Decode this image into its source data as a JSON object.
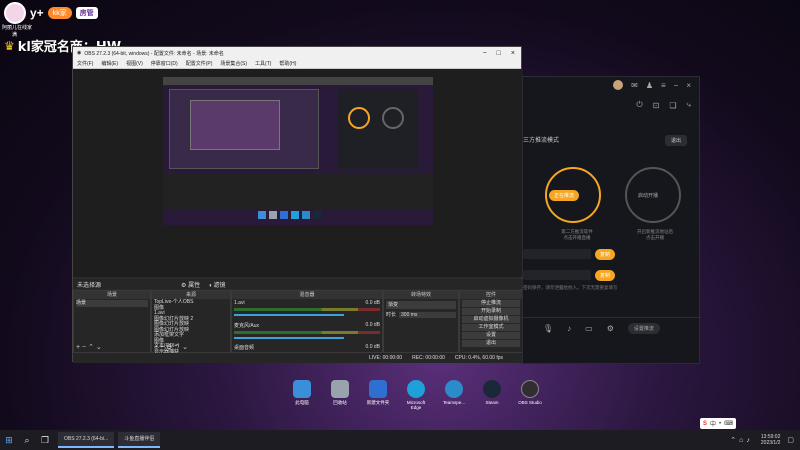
{
  "overlay": {
    "line1_prefix": "y+",
    "badge": "kk家",
    "badge2": "房管",
    "small1": "阿丽儿在线家",
    "small2": "满",
    "name_line": "kl家冠名商：HW"
  },
  "obs": {
    "title": "OBS 27.2.3 (64-bit, windows) - 配置文件: 未命名 - 场景: 未命名",
    "menu": [
      "文件(F)",
      "编辑(E)",
      "视图(V)",
      "停靠窗口(D)",
      "配置文件(P)",
      "场景集合(S)",
      "工具(T)",
      "帮助(H)"
    ],
    "status_label": "未选择源",
    "props_btn": "属性",
    "filters_btn": "滤镜",
    "docks": {
      "scenes": {
        "header": "场景",
        "items": [
          "场景"
        ]
      },
      "sources": {
        "header": "来源",
        "items": [
          "TopLive-个人OBS",
          "图像",
          "1.avi",
          "图像幻灯片放映 2",
          "图像幻灯片放映",
          "图像幻灯片放映",
          "添加框架文字",
          "图像",
          "文本(GDI+)",
          "显示器捕获"
        ]
      },
      "mixer": {
        "header": "混音器",
        "channels": [
          {
            "name": "1.avi",
            "db": "0.0 dB"
          },
          {
            "name": "麦克风/Aux",
            "db": "0.0 dB"
          },
          {
            "name": "桌面音频",
            "db": "0.0 dB"
          }
        ]
      },
      "transitions": {
        "header": "转场特效",
        "type": "渐变",
        "duration_label": "时长",
        "duration": "300 ms"
      },
      "controls": {
        "header": "控件",
        "buttons": [
          "停止推流",
          "开始录制",
          "启动虚拟摄像机",
          "工作室模式",
          "设置",
          "退出"
        ]
      }
    },
    "bottom_status": [
      "LIVE: 00:00:00",
      "REC: 00:00:00",
      "CPU: 0.4%, 60.00 fps"
    ]
  },
  "right_app": {
    "mode_label": "三方推流模式",
    "exit_btn": "退出",
    "left_pill": "正在推流",
    "right_pill": "启动开播",
    "left_caption": "第二方推流软件",
    "left_sub": "点击开播直播",
    "right_caption": "开启新推流地址后",
    "right_sub": "点击开播",
    "copy_btn": "复制",
    "hint": "密码保存，请勿泄露给他人。下次无需重复填写",
    "bottom_btn": "设置推流"
  },
  "desktop_icons": [
    {
      "label": "此电脑",
      "color": "#3b8fd9"
    },
    {
      "label": "回收站",
      "color": "#9aa3ad"
    },
    {
      "label": "新建文件夹",
      "color": "#2f6fd1"
    },
    {
      "label": "Microsoft Edge",
      "color": "#1fa0d8"
    },
    {
      "label": "Teamspe...",
      "color": "#2c8cc9"
    },
    {
      "label": "Steam",
      "color": "#1b2838"
    },
    {
      "label": "OBS Studio",
      "color": "#302e31"
    }
  ],
  "taskbar": {
    "task1": "OBS 27.2.3 (64-bi...",
    "task2": "斗鱼直播伴侣",
    "time": "13:59:02",
    "date": "2023/1/2",
    "ime_lang": "中"
  }
}
